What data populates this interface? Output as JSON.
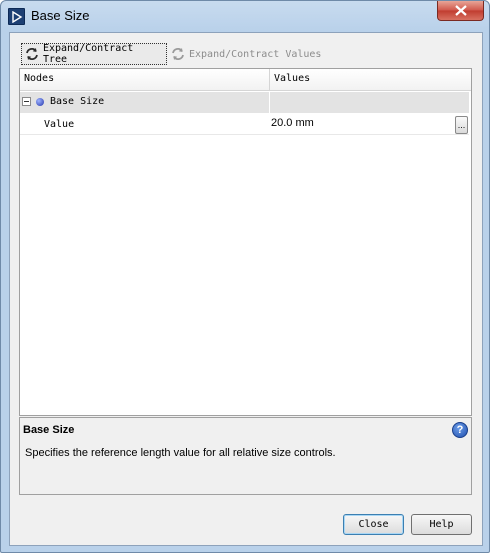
{
  "window": {
    "title": "Base Size"
  },
  "toolbar": {
    "expand_tree_label": "Expand/Contract Tree",
    "expand_values_label": "Expand/Contract Values"
  },
  "tree": {
    "columns": [
      "Nodes",
      "Values"
    ],
    "group": {
      "label": "Base Size",
      "expanded": true
    },
    "rows": [
      {
        "name": "Value",
        "value": "20.0 mm",
        "action_label": "..."
      }
    ]
  },
  "description": {
    "title": "Base Size",
    "text": "Specifies the reference length value for all relative size controls.",
    "help_glyph": "?"
  },
  "buttons": {
    "close_label": "Close",
    "help_label": "Help"
  },
  "colors": {
    "titlebar": "#b9d1ea",
    "client_bg": "#f0f0f0",
    "group_row_bg": "#e3e3e3",
    "close_button": "#c8473b",
    "help_icon": "#2a5fc4"
  }
}
